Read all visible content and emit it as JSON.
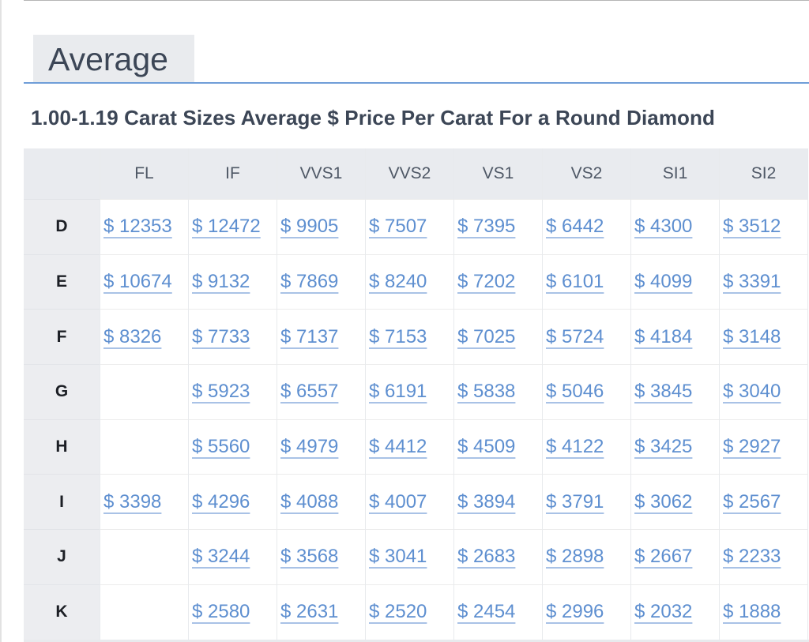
{
  "section": {
    "tab_label": "Average"
  },
  "table": {
    "title": "1.00-1.19 Carat Sizes Average $ Price Per Carat For a Round Diamond",
    "columns": [
      "FL",
      "IF",
      "VVS1",
      "VVS2",
      "VS1",
      "VS2",
      "SI1",
      "SI2"
    ],
    "rows": [
      {
        "label": "D",
        "cells": [
          "$ 12353",
          "$ 12472",
          "$ 9905",
          "$ 7507",
          "$ 7395",
          "$ 6442",
          "$ 4300",
          "$ 3512"
        ]
      },
      {
        "label": "E",
        "cells": [
          "$ 10674",
          "$ 9132",
          "$ 7869",
          "$ 8240",
          "$ 7202",
          "$ 6101",
          "$ 4099",
          "$ 3391"
        ]
      },
      {
        "label": "F",
        "cells": [
          "$ 8326",
          "$ 7733",
          "$ 7137",
          "$ 7153",
          "$ 7025",
          "$ 5724",
          "$ 4184",
          "$ 3148"
        ]
      },
      {
        "label": "G",
        "cells": [
          "",
          "$ 5923",
          "$ 6557",
          "$ 6191",
          "$ 5838",
          "$ 5046",
          "$ 3845",
          "$ 3040"
        ]
      },
      {
        "label": "H",
        "cells": [
          "",
          "$ 5560",
          "$ 4979",
          "$ 4412",
          "$ 4509",
          "$ 4122",
          "$ 3425",
          "$ 2927"
        ]
      },
      {
        "label": "I",
        "cells": [
          "$ 3398",
          "$ 4296",
          "$ 4088",
          "$ 4007",
          "$ 3894",
          "$ 3791",
          "$ 3062",
          "$ 2567"
        ]
      },
      {
        "label": "J",
        "cells": [
          "",
          "$ 3244",
          "$ 3568",
          "$ 3041",
          "$ 2683",
          "$ 2898",
          "$ 2667",
          "$ 2233"
        ]
      },
      {
        "label": "K",
        "cells": [
          "",
          "$ 2580",
          "$ 2631",
          "$ 2520",
          "$ 2454",
          "$ 2996",
          "$ 2032",
          "$ 1888"
        ]
      }
    ]
  }
}
